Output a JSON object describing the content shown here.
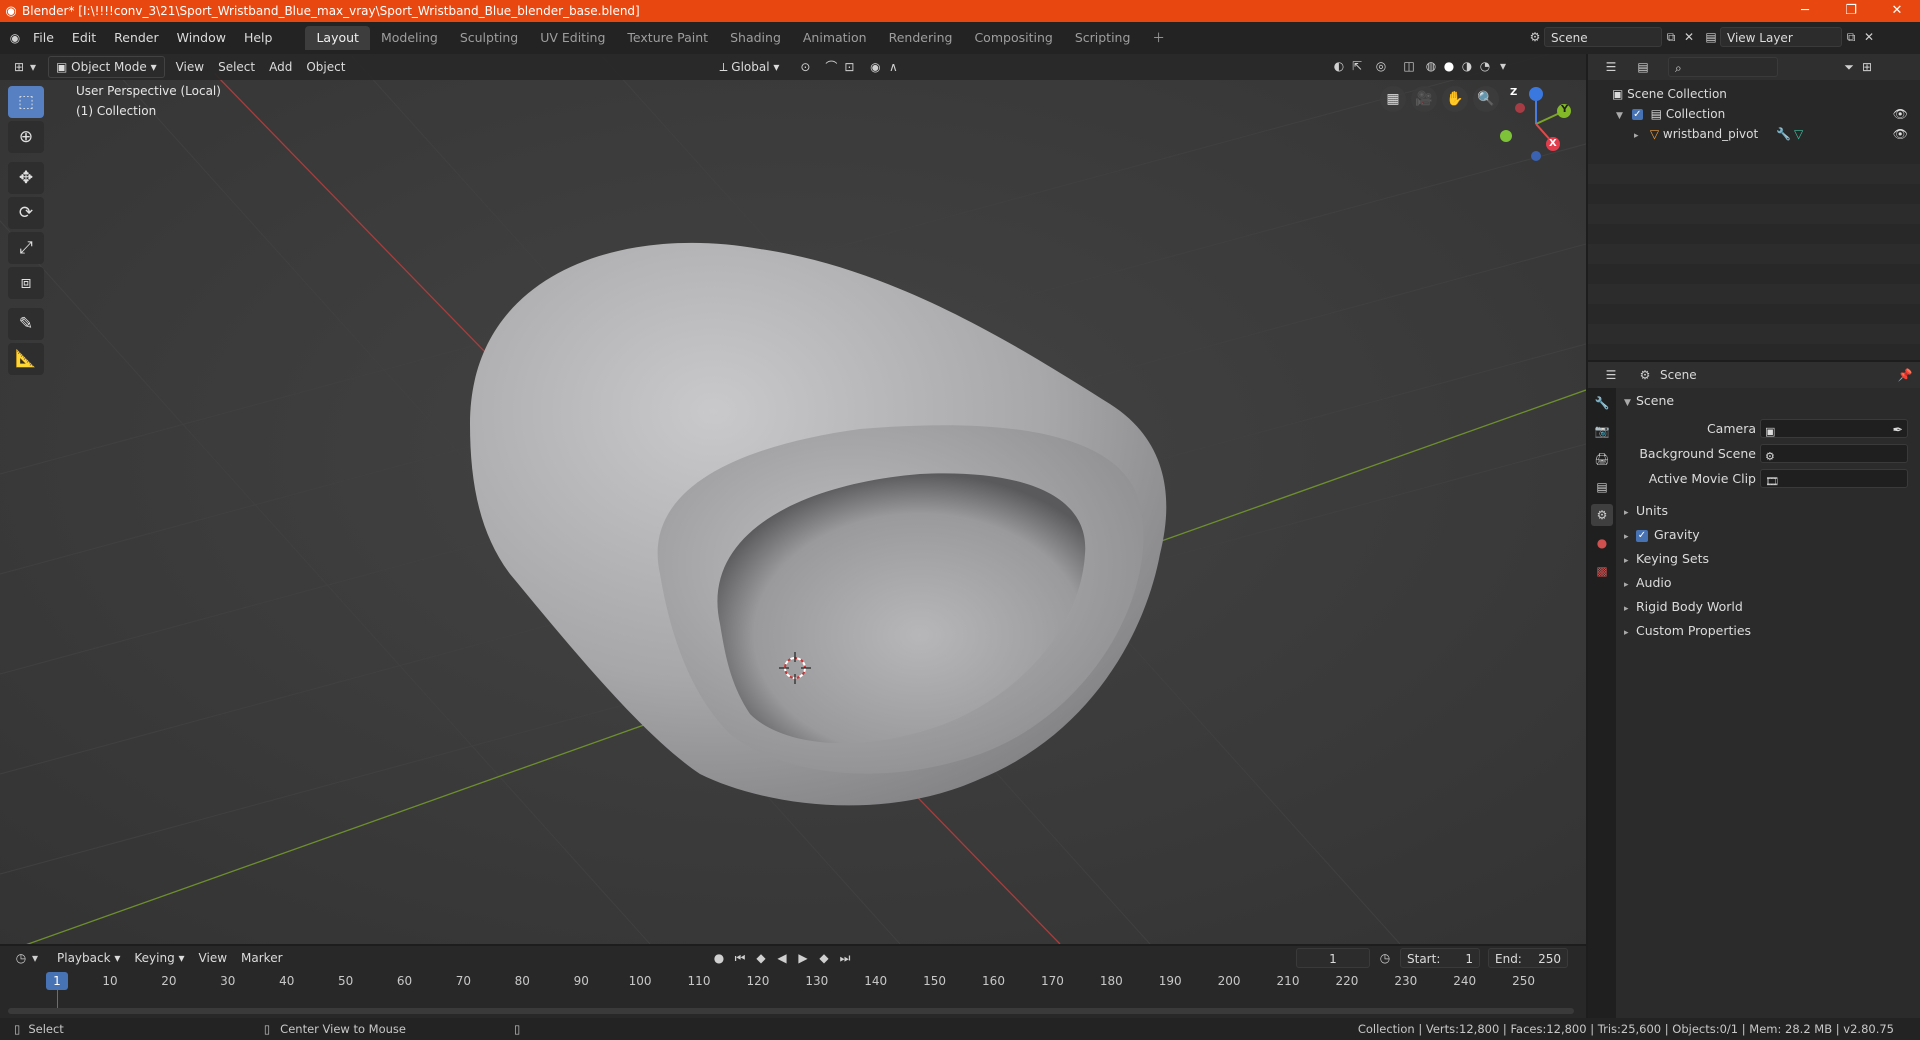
{
  "window": {
    "title": "Blender* [I:\\!!!!conv_3\\21\\Sport_Wristband_Blue_max_vray\\Sport_Wristband_Blue_blender_base.blend]"
  },
  "menu": [
    "File",
    "Edit",
    "Render",
    "Window",
    "Help"
  ],
  "workspaces": [
    "Layout",
    "Modeling",
    "Sculpting",
    "UV Editing",
    "Texture Paint",
    "Shading",
    "Animation",
    "Rendering",
    "Compositing",
    "Scripting"
  ],
  "scene_field": "Scene",
  "view_layer_field": "View Layer",
  "viewport": {
    "mode": "Object Mode",
    "menus": [
      "View",
      "Select",
      "Add",
      "Object"
    ],
    "transform_orientation": "Global",
    "perspective_label": "User Perspective (Local)",
    "collection_label": "(1) Collection",
    "gizmo": {
      "x": "X",
      "y": "Y",
      "z": "Z"
    }
  },
  "outliner": {
    "scene_collection": "Scene Collection",
    "collection": "Collection",
    "object": "wristband_pivot"
  },
  "properties": {
    "header": "Scene",
    "panel_title": "Scene",
    "fields": [
      {
        "label": "Camera"
      },
      {
        "label": "Background Scene"
      },
      {
        "label": "Active Movie Clip"
      }
    ],
    "subpanels": [
      "Units",
      "Gravity",
      "Keying Sets",
      "Audio",
      "Rigid Body World",
      "Custom Properties"
    ]
  },
  "timeline": {
    "menus": [
      "Playback",
      "Keying",
      "View",
      "Marker"
    ],
    "current_frame": "1",
    "start_label": "Start:",
    "start_value": "1",
    "end_label": "End:",
    "end_value": "250",
    "ruler_current": "1",
    "ruler_ticks": [
      "10",
      "20",
      "30",
      "40",
      "50",
      "60",
      "70",
      "80",
      "90",
      "100",
      "110",
      "120",
      "130",
      "140",
      "150",
      "160",
      "170",
      "180",
      "190",
      "200",
      "210",
      "220",
      "230",
      "240",
      "250"
    ]
  },
  "status": {
    "left_action": "Select",
    "middle_action": "Center View to Mouse",
    "stats": "Collection | Verts:12,800 | Faces:12,800 | Tris:25,600 | Objects:0/1 | Mem: 28.2 MB | v2.80.75"
  }
}
